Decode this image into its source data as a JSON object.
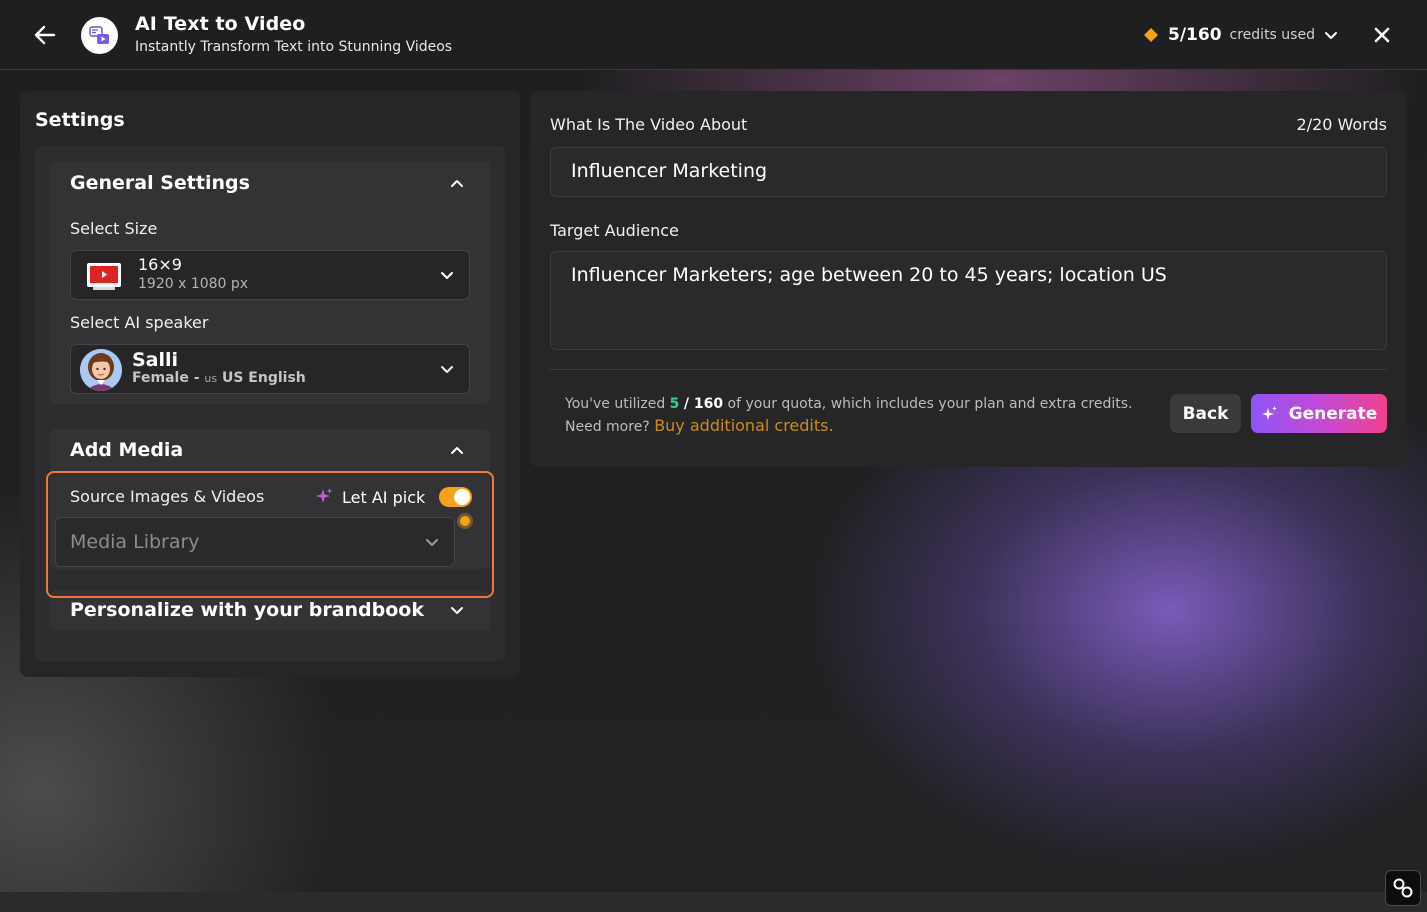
{
  "header": {
    "title": "AI Text to Video",
    "subtitle": "Instantly Transform Text into Stunning Videos",
    "credits_count": "5/160",
    "credits_label": "credits used"
  },
  "settings": {
    "title": "Settings",
    "general": {
      "title": "General Settings",
      "size_label": "Select Size",
      "size_value": "16×9",
      "size_dims": "1920 x 1080 px",
      "speaker_label": "Select AI speaker",
      "speaker_name": "Salli",
      "speaker_gender": "Female - ",
      "speaker_flag": "us",
      "speaker_language": " US English"
    },
    "media": {
      "title": "Add Media",
      "source_label": "Source Images & Videos",
      "ai_pick_label": "Let AI pick",
      "ai_pick_enabled": true,
      "media_placeholder": "Media Library"
    },
    "brandbook": {
      "title": "Personalize with your brandbook"
    }
  },
  "main": {
    "about_label": "What Is The Video About",
    "word_count": "2/20 Words",
    "about_value": "Influencer Marketing",
    "audience_label": "Target Audience",
    "audience_value": "Influencer Marketers; age between 20 to 45 years; location US",
    "quota_prefix": "You've utilized ",
    "quota_used": "5",
    "quota_total": "/ 160",
    "quota_suffix": " of your quota, which includes your plan and extra credits.",
    "quota_more": "Need more? ",
    "buy_link": "Buy additional credits.",
    "back_label": "Back",
    "generate_label": "Generate"
  },
  "colors": {
    "accent_orange": "#f6a11a",
    "highlight_border": "#f0783c",
    "quota_green": "#39d28a",
    "buy_link": "#c98d1c",
    "generate_gradient_start": "#8f54f5",
    "generate_gradient_end": "#f0428c"
  }
}
